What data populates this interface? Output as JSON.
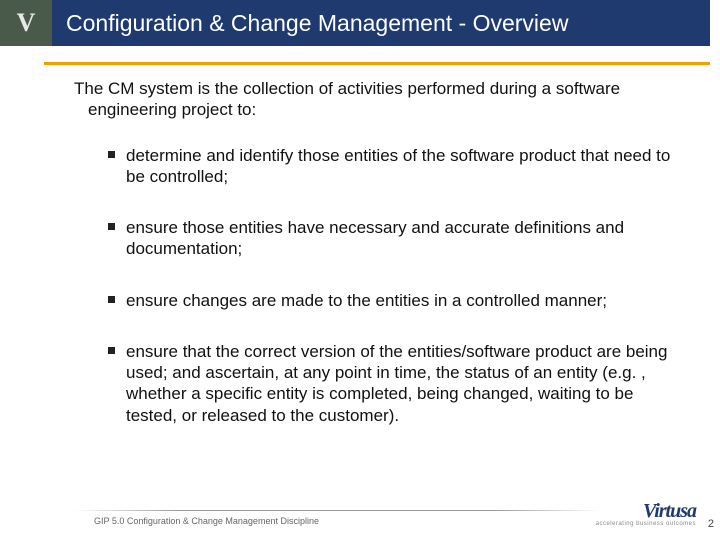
{
  "header": {
    "logo_letter": "V",
    "title": "Configuration & Change Management - Overview"
  },
  "content": {
    "intro": "The CM system is the collection of activities performed during a software engineering project to:",
    "bullets": [
      "determine and identify those entities of the software product that need to be controlled;",
      "ensure those entities have necessary and accurate definitions and documentation;",
      "ensure changes are made to the entities in a controlled manner;",
      "ensure that the correct version of the entities/software product are being used; and ascertain, at any point in time, the status of an entity (e.g. , whether a specific entity is completed, being changed, waiting to be tested, or released to the customer)."
    ]
  },
  "footer": {
    "text": "GIP 5.0 Configuration & Change Management Discipline",
    "brand": "Virtusa",
    "tagline": "accelerating business outcomes",
    "page": "2"
  }
}
